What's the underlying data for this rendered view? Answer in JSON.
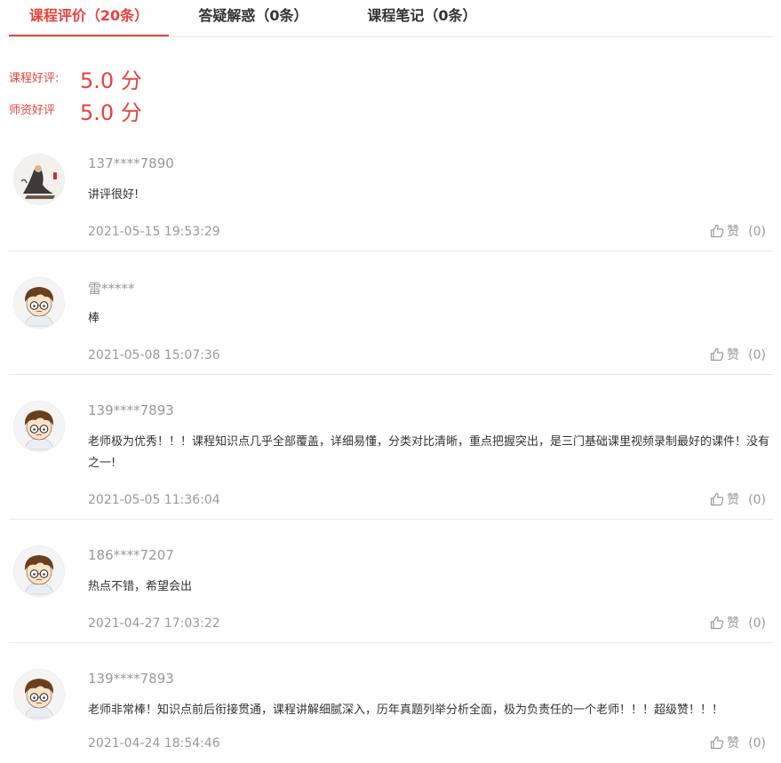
{
  "tabs": [
    {
      "label": "课程评价（20条）",
      "active": true
    },
    {
      "label": "答疑解惑（0条）",
      "active": false
    },
    {
      "label": "课程笔记（0条）",
      "active": false
    }
  ],
  "ratings": [
    {
      "label": "课程好评:",
      "value": "5.0 分"
    },
    {
      "label": "师资好评",
      "value": "5.0 分"
    }
  ],
  "reviews": [
    {
      "user": "137****7890",
      "avatar": "painting-avatar",
      "content": "讲评很好!",
      "date": "2021-05-15 19:53:29",
      "like_label": "赞",
      "like_count": "(0)"
    },
    {
      "user": "雷*****",
      "avatar": "cartoon-boy-avatar",
      "content": "棒",
      "date": "2021-05-08 15:07:36",
      "like_label": "赞",
      "like_count": "(0)"
    },
    {
      "user": "139****7893",
      "avatar": "cartoon-boy-avatar",
      "content": "老师极为优秀！！！课程知识点几乎全部覆盖，详细易懂，分类对比清晰，重点把握突出，是三门基础课里视频录制最好的课件！没有之一!",
      "date": "2021-05-05 11:36:04",
      "like_label": "赞",
      "like_count": "(0)"
    },
    {
      "user": "186****7207",
      "avatar": "cartoon-boy-avatar",
      "content": "热点不错，希望会出",
      "date": "2021-04-27 17:03:22",
      "like_label": "赞",
      "like_count": "(0)"
    },
    {
      "user": "139****7893",
      "avatar": "cartoon-boy-avatar",
      "content": "老师非常棒！知识点前后衔接贯通，课程讲解细腻深入，历年真题列举分析全面，极为负责任的一个老师！！！超级赞！！！",
      "date": "2021-04-24 18:54:46",
      "like_label": "赞",
      "like_count": "(0)"
    }
  ],
  "colors": {
    "accent": "#e8423d",
    "muted": "#999999",
    "text": "#333333"
  }
}
